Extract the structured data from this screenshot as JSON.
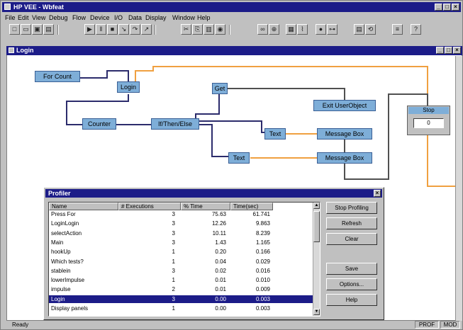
{
  "app": {
    "title": "HP VEE - Wbfeat"
  },
  "menu": [
    "File",
    "Edit",
    "View",
    "Debug",
    "Flow",
    "Device",
    "I/O",
    "Data",
    "Display",
    "Window",
    "Help"
  ],
  "toolbar": {
    "buttons": [
      {
        "icon": "new-icon",
        "glyph": "□"
      },
      {
        "icon": "open-icon",
        "glyph": "▭"
      },
      {
        "icon": "save-icon",
        "glyph": "▣"
      },
      {
        "icon": "print-icon",
        "glyph": "▤"
      },
      {
        "icon": "run-icon",
        "glyph": "▶"
      },
      {
        "icon": "pause-icon",
        "glyph": "‖"
      },
      {
        "icon": "stop-icon",
        "glyph": "■"
      },
      {
        "icon": "step-into-icon",
        "glyph": "↘"
      },
      {
        "icon": "step-over-icon",
        "glyph": "↷"
      },
      {
        "icon": "step-out-icon",
        "glyph": "↗"
      },
      {
        "icon": "cut-icon",
        "glyph": "✂"
      },
      {
        "icon": "copy-icon",
        "glyph": "⎘"
      },
      {
        "icon": "paste-icon",
        "glyph": "▥"
      },
      {
        "icon": "globe-icon",
        "glyph": "◉"
      },
      {
        "icon": "binoculars-icon",
        "glyph": "∞"
      },
      {
        "icon": "zoom-icon",
        "glyph": "⊕"
      },
      {
        "icon": "panel-icon",
        "glyph": "▦"
      },
      {
        "icon": "line-probe-icon",
        "glyph": "⌇"
      },
      {
        "icon": "breakpoint-icon",
        "glyph": "●"
      },
      {
        "icon": "connect-icon",
        "glyph": "⊶"
      },
      {
        "icon": "grid-icon",
        "glyph": "▤"
      },
      {
        "icon": "sync-icon",
        "glyph": "⟲"
      },
      {
        "icon": "align-icon",
        "glyph": "≡"
      },
      {
        "icon": "help-icon",
        "glyph": "?"
      }
    ]
  },
  "workspace": {
    "title": "Login"
  },
  "nodes": {
    "for_count": "For Count",
    "login": "Login",
    "get": "Get",
    "exit_userobject": "Exit UserObject",
    "counter": "Counter",
    "if_then_else": "If/Then/Else",
    "text1": "Text",
    "text2": "Text",
    "message_box1": "Message Box",
    "message_box2": "Message Box"
  },
  "stop_panel": {
    "title": "Stop",
    "value": "0"
  },
  "profiler": {
    "title": "Profiler",
    "columns": [
      "Name",
      "# Executions",
      "% Time",
      "Time(sec)"
    ],
    "rows": [
      {
        "name": "Press For",
        "execs": "3",
        "pct": "75.63",
        "time": "61.741",
        "selected": false
      },
      {
        "name": "LoginLogin",
        "execs": "3",
        "pct": "12.26",
        "time": "9.863",
        "selected": false
      },
      {
        "name": "selectAction",
        "execs": "3",
        "pct": "10.11",
        "time": "8.239",
        "selected": false
      },
      {
        "name": "Main",
        "execs": "3",
        "pct": "1.43",
        "time": "1.165",
        "selected": false
      },
      {
        "name": "hookUp",
        "execs": "1",
        "pct": "0.20",
        "time": "0.166",
        "selected": false
      },
      {
        "name": "Which tests?",
        "execs": "1",
        "pct": "0.04",
        "time": "0.029",
        "selected": false
      },
      {
        "name": "stablein",
        "execs": "3",
        "pct": "0.02",
        "time": "0.016",
        "selected": false
      },
      {
        "name": "lowerImpulse",
        "execs": "1",
        "pct": "0.01",
        "time": "0.010",
        "selected": false
      },
      {
        "name": "impulse",
        "execs": "2",
        "pct": "0.01",
        "time": "0.009",
        "selected": false
      },
      {
        "name": "Login",
        "execs": "3",
        "pct": "0.00",
        "time": "0.003",
        "selected": true
      },
      {
        "name": "Display panels",
        "execs": "1",
        "pct": "0.00",
        "time": "0.003",
        "selected": false
      }
    ],
    "buttons": {
      "stop_profiling": "Stop Profiling",
      "refresh": "Refresh",
      "clear": "Clear",
      "save": "Save",
      "options": "Options...",
      "help": "Help"
    }
  },
  "status": {
    "ready": "Ready",
    "prof": "PROF",
    "mod": "MOD"
  },
  "colors": {
    "titlebar": "#1c1c88",
    "node": "#7eaed8",
    "data_line": "#2c2c6c",
    "control_line": "#f0a040",
    "seq_line": "#606060"
  }
}
